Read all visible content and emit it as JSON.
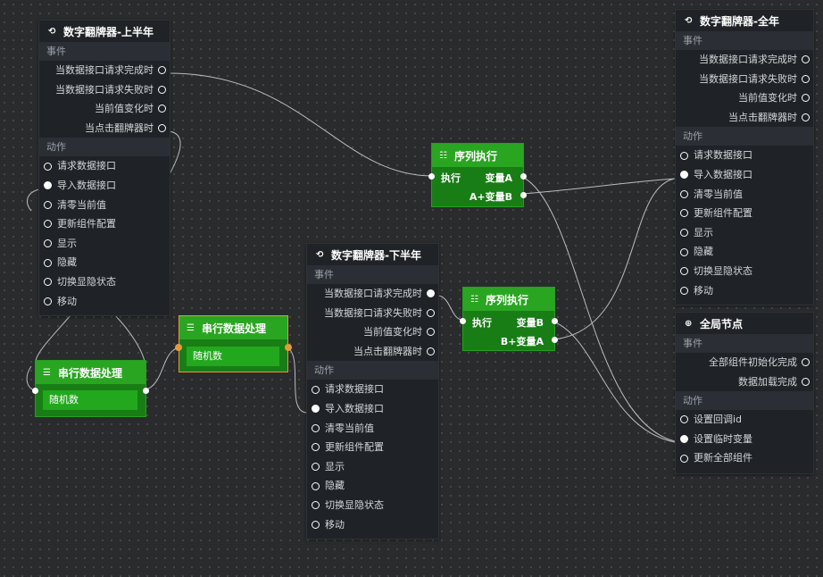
{
  "labels": {
    "events": "事件",
    "actions": "动作"
  },
  "flipper_h1": {
    "title": "数字翻牌器-上半年",
    "events": [
      "当数据接口请求完成时",
      "当数据接口请求失败时",
      "当前值变化时",
      "当点击翻牌器时"
    ],
    "actions": [
      "请求数据接口",
      "导入数据接口",
      "清零当前值",
      "更新组件配置",
      "显示",
      "隐藏",
      "切换显隐状态",
      "移动"
    ]
  },
  "flipper_h2": {
    "title": "数字翻牌器-下半年",
    "events": [
      "当数据接口请求完成时",
      "当数据接口请求失败时",
      "当前值变化时",
      "当点击翻牌器时"
    ],
    "actions": [
      "请求数据接口",
      "导入数据接口",
      "清零当前值",
      "更新组件配置",
      "显示",
      "隐藏",
      "切换显隐状态",
      "移动"
    ]
  },
  "flipper_year": {
    "title": "数字翻牌器-全年",
    "events": [
      "当数据接口请求完成时",
      "当数据接口请求失败时",
      "当前值变化时",
      "当点击翻牌器时"
    ],
    "actions": [
      "请求数据接口",
      "导入数据接口",
      "清零当前值",
      "更新组件配置",
      "显示",
      "隐藏",
      "切换显隐状态",
      "移动"
    ]
  },
  "global_node": {
    "title": "全局节点",
    "events": [
      "全部组件初始化完成",
      "数据加载完成"
    ],
    "actions": [
      "设置回调id",
      "设置临时变量",
      "更新全部组件"
    ]
  },
  "seq_top": {
    "title": "序列执行",
    "input": "执行",
    "out1": "变量A",
    "out2": "A+变量B"
  },
  "seq_mid": {
    "title": "序列执行",
    "input": "执行",
    "out1": "变量B",
    "out2": "B+变量A"
  },
  "serial_left": {
    "title": "串行数据处理",
    "body": "随机数"
  },
  "serial_mid": {
    "title": "串行数据处理",
    "body": "随机数"
  },
  "colors": {
    "canvas": "#2a2b2d",
    "node": "#1f2226",
    "green": "#2aa521",
    "selected": "#e29a3b"
  }
}
